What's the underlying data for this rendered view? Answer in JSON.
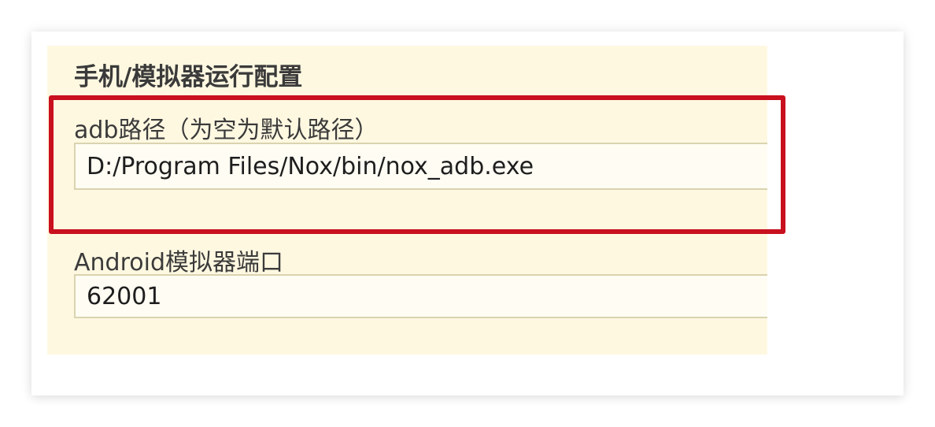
{
  "section": {
    "title": "手机/模拟器运行配置"
  },
  "fields": {
    "adb_path": {
      "label": "adb路径（为空为默认路径）",
      "value": "D:/Program Files/Nox/bin/nox_adb.exe"
    },
    "emulator_port": {
      "label": "Android模拟器端口",
      "value": "62001"
    }
  },
  "colors": {
    "panel_background": "#fff8e1",
    "highlight_border": "#c8101e"
  }
}
